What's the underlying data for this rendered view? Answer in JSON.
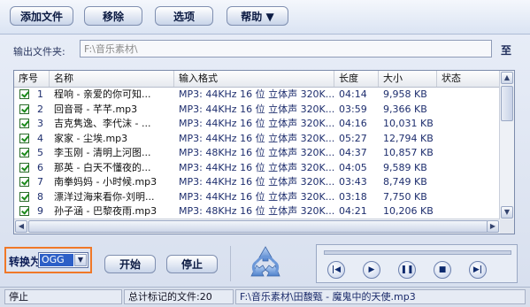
{
  "toolbar": {
    "add_file": "添加文件",
    "remove": "移除",
    "options": "选项",
    "help": "帮助 ▼"
  },
  "output": {
    "label": "输出文件夹:",
    "value": "F:\\音乐素材\\",
    "browse": "至"
  },
  "list": {
    "headers": [
      "序号",
      "名称",
      "输入格式",
      "长度",
      "大小",
      "状态"
    ],
    "rows": [
      {
        "num": "1",
        "name": "程响 - 亲爱的你可知...",
        "format": "MP3: 44KHz 16 位 立体声 320K...",
        "length": "04:14",
        "size": "9,958 KB",
        "status": ""
      },
      {
        "num": "2",
        "name": "回音哥 - 芊芊.mp3",
        "format": "MP3: 44KHz 16 位 立体声 320K...",
        "length": "03:59",
        "size": "9,366 KB",
        "status": ""
      },
      {
        "num": "3",
        "name": "吉克隽逸、李代沫 - ...",
        "format": "MP3: 44KHz 16 位 立体声 320K...",
        "length": "04:16",
        "size": "10,031 KB",
        "status": ""
      },
      {
        "num": "4",
        "name": "家家 - 尘埃.mp3",
        "format": "MP3: 44KHz 16 位 立体声 320K...",
        "length": "05:27",
        "size": "12,794 KB",
        "status": ""
      },
      {
        "num": "5",
        "name": "李玉刚 - 清明上河图...",
        "format": "MP3: 48KHz 16 位 立体声 320K...",
        "length": "04:37",
        "size": "10,857 KB",
        "status": ""
      },
      {
        "num": "6",
        "name": "那英 - 白天不懂夜的...",
        "format": "MP3: 44KHz 16 位 立体声 320K...",
        "length": "04:05",
        "size": "9,589 KB",
        "status": ""
      },
      {
        "num": "7",
        "name": "南拳妈妈 - 小时候.mp3",
        "format": "MP3: 44KHz 16 位 立体声 320K...",
        "length": "03:43",
        "size": "8,749 KB",
        "status": ""
      },
      {
        "num": "8",
        "name": "漂洋过海来看你-刘明...",
        "format": "MP3: 44KHz 16 位 立体声 320K...",
        "length": "03:18",
        "size": "7,750 KB",
        "status": ""
      },
      {
        "num": "9",
        "name": "孙子涵 - 巴黎夜雨.mp3",
        "format": "MP3: 48KHz 16 位 立体声 320K...",
        "length": "04:21",
        "size": "10,206 KB",
        "status": ""
      }
    ]
  },
  "convert": {
    "label": "转换为",
    "selected": "OGG"
  },
  "controls": {
    "start": "开始",
    "stop": "停止",
    "progress": 0
  },
  "status": {
    "state": "停止",
    "total": "总计标记的文件:20",
    "current_file": "F:\\音乐素材\\田馥甄 - 魔鬼中的天使.mp3"
  }
}
